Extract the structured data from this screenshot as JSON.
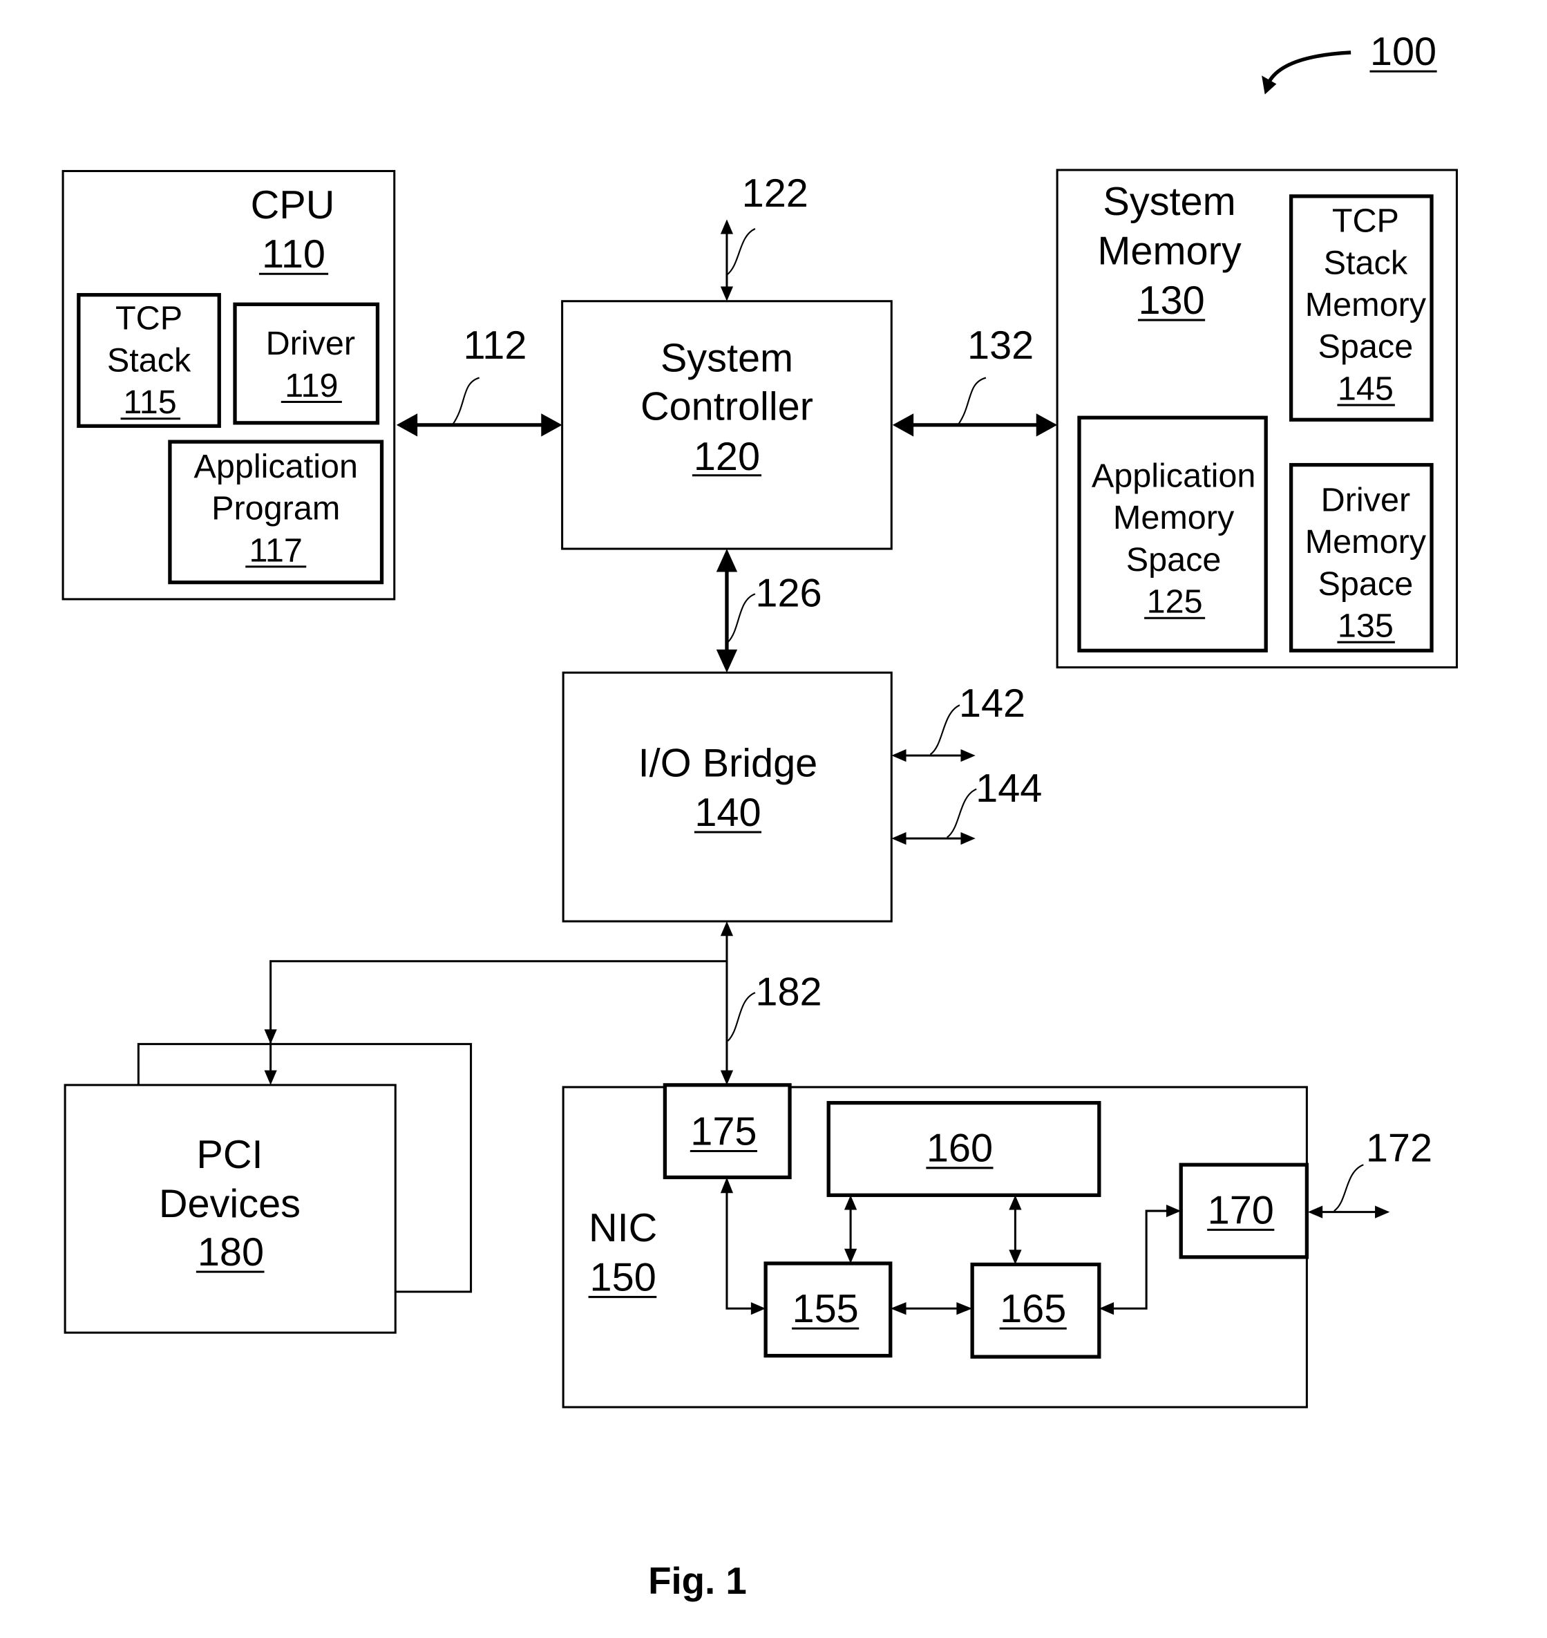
{
  "figure": {
    "caption": "Fig. 1",
    "reference": "100"
  },
  "blocks": {
    "cpu": {
      "title": "CPU",
      "ref": "110"
    },
    "tcp_stack": {
      "lines": [
        "TCP",
        "Stack"
      ],
      "ref": "115"
    },
    "driver": {
      "lines": [
        "Driver"
      ],
      "ref": "119"
    },
    "application_program": {
      "lines": [
        "Application",
        "Program"
      ],
      "ref": "117"
    },
    "system_controller": {
      "lines": [
        "System",
        "Controller"
      ],
      "ref": "120"
    },
    "system_memory": {
      "lines": [
        "System",
        "Memory"
      ],
      "ref": "130"
    },
    "tcp_stack_memory_space": {
      "lines": [
        "TCP",
        "Stack",
        "Memory",
        "Space"
      ],
      "ref": "145"
    },
    "application_memory_space": {
      "lines": [
        "Application",
        "Memory",
        "Space"
      ],
      "ref": "125"
    },
    "driver_memory_space": {
      "lines": [
        "Driver",
        "Memory",
        "Space"
      ],
      "ref": "135"
    },
    "io_bridge": {
      "lines": [
        "I/O Bridge"
      ],
      "ref": "140"
    },
    "pci_devices": {
      "lines": [
        "PCI",
        "Devices"
      ],
      "ref": "180"
    },
    "nic": {
      "lines": [
        "NIC"
      ],
      "ref": "150"
    },
    "nic_175": {
      "ref": "175"
    },
    "nic_160": {
      "ref": "160"
    },
    "nic_155": {
      "ref": "155"
    },
    "nic_165": {
      "ref": "165"
    },
    "nic_170": {
      "ref": "170"
    }
  },
  "connections": {
    "bus_112": "112",
    "bus_122": "122",
    "bus_132": "132",
    "bus_126": "126",
    "bus_142": "142",
    "bus_144": "144",
    "bus_182": "182",
    "bus_172": "172"
  }
}
